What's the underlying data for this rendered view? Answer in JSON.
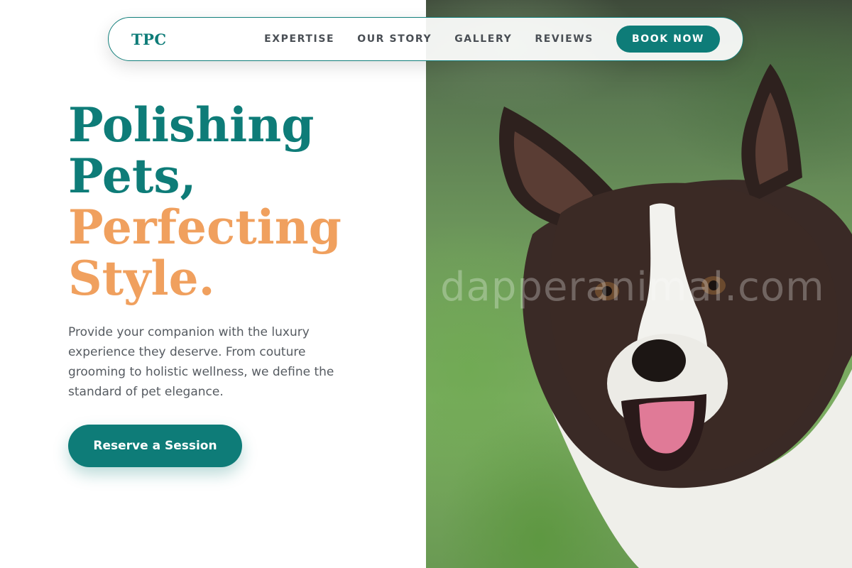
{
  "brand": {
    "logo_text": "TPC"
  },
  "nav": {
    "links": [
      "EXPERTISE",
      "OUR STORY",
      "GALLERY",
      "REVIEWS"
    ],
    "cta_label": "BOOK NOW"
  },
  "hero": {
    "headline_line1": "Polishing",
    "headline_line2": "Pets,",
    "headline_line3": "Perfecting",
    "headline_line4": "Style.",
    "description": "Provide your companion with the luxury experience they deserve. From couture grooming to holistic wellness, we define the standard of pet elegance.",
    "cta_label": "Reserve a Session",
    "watermark_text": "dapperanimal.com"
  },
  "colors": {
    "primary_teal": "#0e7c78",
    "accent_peach": "#f0a05e",
    "body_text": "#565b61",
    "nav_text": "#4a4f55"
  }
}
